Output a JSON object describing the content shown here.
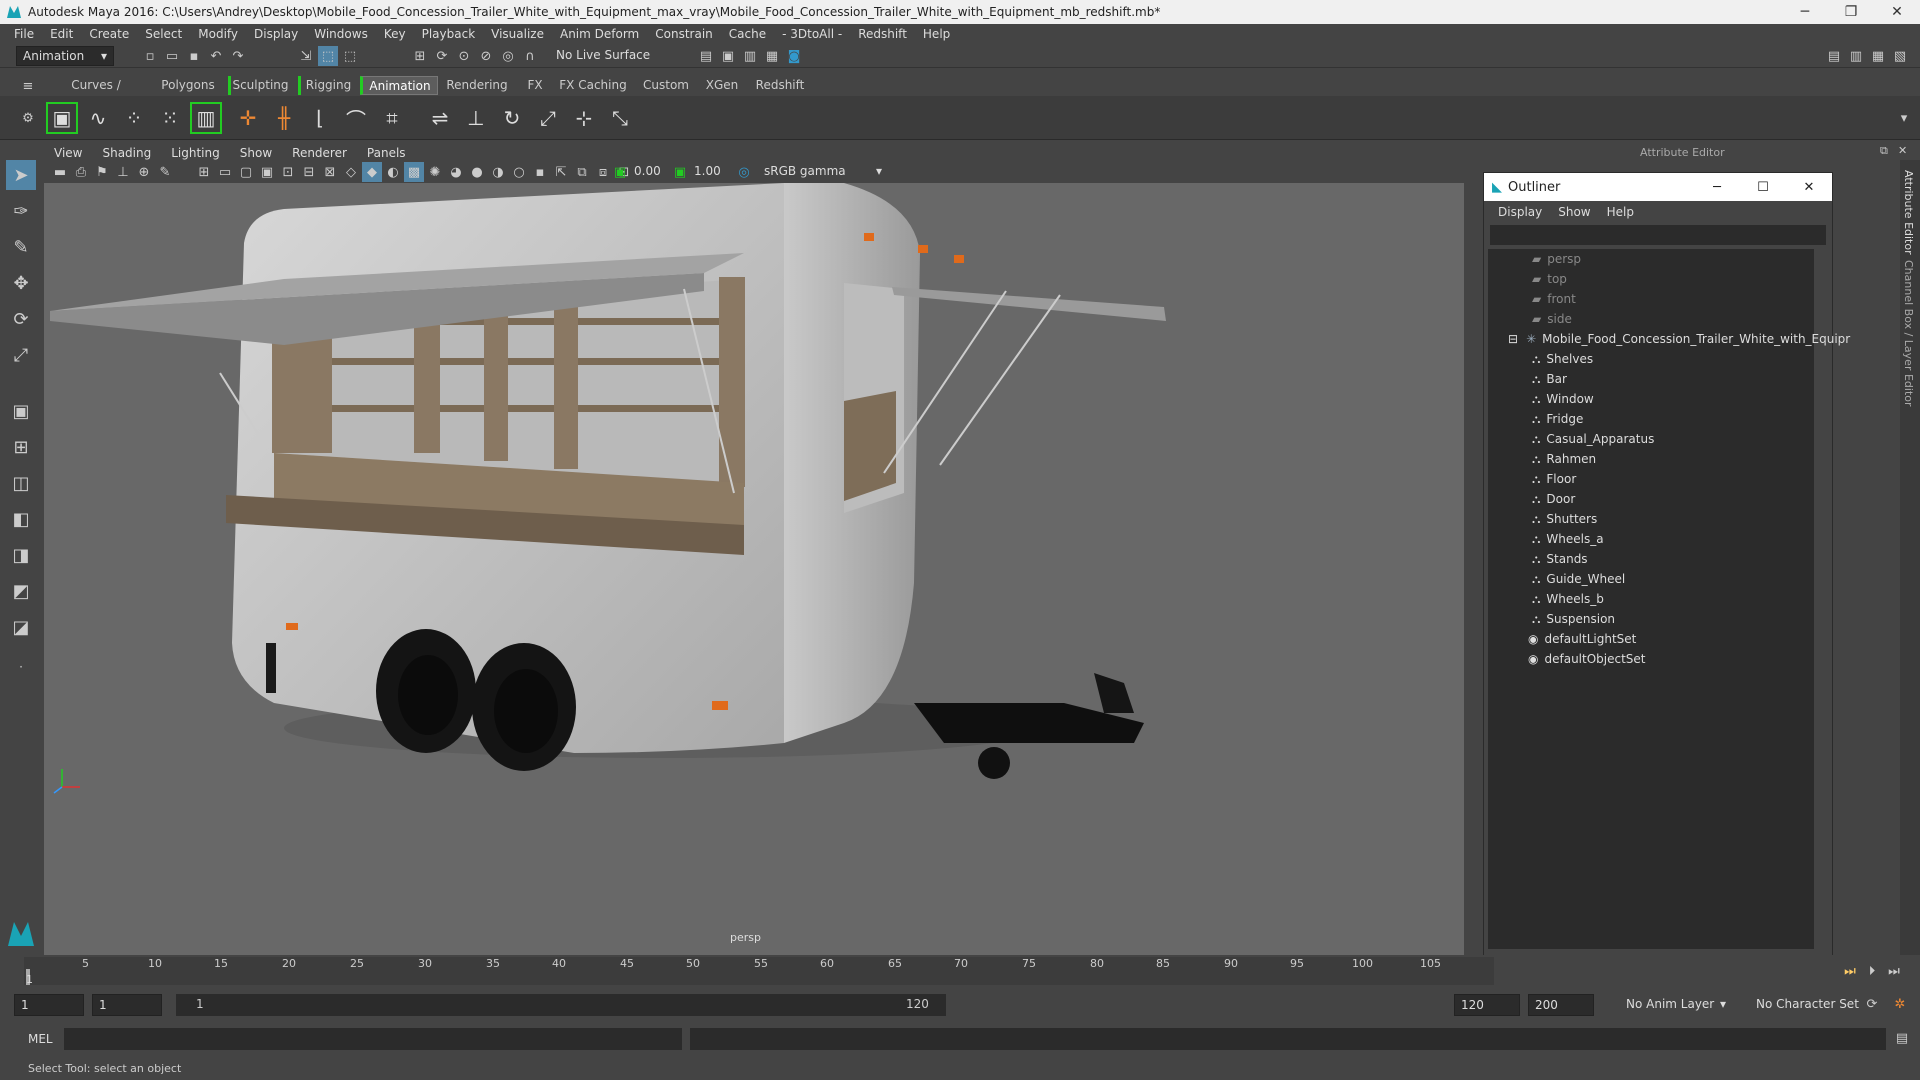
{
  "window": {
    "title": "Autodesk Maya 2016: C:\\Users\\Andrey\\Desktop\\Mobile_Food_Concession_Trailer_White_with_Equipment_max_vray\\Mobile_Food_Concession_Trailer_White_with_Equipment_mb_redshift.mb*",
    "minimize": "─",
    "restore": "❐",
    "close": "✕"
  },
  "menu": [
    "File",
    "Edit",
    "Create",
    "Select",
    "Modify",
    "Display",
    "Windows",
    "Key",
    "Playback",
    "Visualize",
    "Anim Deform",
    "Constrain",
    "Cache",
    "- 3DtoAll -",
    "Redshift",
    "Help"
  ],
  "status_line": {
    "mode": "Animation",
    "live_surface": "No Live Surface"
  },
  "shelf_tabs": [
    "Curves / Surfaces",
    "Polygons",
    "Sculpting",
    "Rigging",
    "Animation",
    "Rendering",
    "FX",
    "FX Caching",
    "Custom",
    "XGen",
    "Redshift"
  ],
  "active_shelf_tab": "Animation",
  "panel_menu": [
    "View",
    "Shading",
    "Lighting",
    "Show",
    "Renderer",
    "Panels"
  ],
  "panel_toolbar": {
    "exposure": "0.00",
    "gamma": "1.00",
    "color_space": "sRGB gamma"
  },
  "viewport": {
    "camera_label": "persp"
  },
  "attribute_editor": {
    "title": "Attribute Editor",
    "side_tab_1": "Attribute Editor",
    "side_tab_2": "Channel Box / Layer Editor"
  },
  "outliner": {
    "title": "Outliner",
    "menu": [
      "Display",
      "Show",
      "Help"
    ],
    "cameras": [
      "persp",
      "top",
      "front",
      "side"
    ],
    "root": "Mobile_Food_Concession_Trailer_White_with_Equipr",
    "children": [
      "Shelves",
      "Bar",
      "Window",
      "Fridge",
      "Casual_Apparatus",
      "Rahmen",
      "Floor",
      "Door",
      "Shutters",
      "Wheels_a",
      "Stands",
      "Guide_Wheel",
      "Wheels_b",
      "Suspension"
    ],
    "sets": [
      "defaultLightSet",
      "defaultObjectSet"
    ]
  },
  "timeline": {
    "ticks": [
      "5",
      "10",
      "15",
      "20",
      "25",
      "30",
      "35",
      "40",
      "45",
      "50",
      "55",
      "60",
      "65",
      "70",
      "75",
      "80",
      "85",
      "90",
      "95",
      "100",
      "105"
    ],
    "current_frame": "1"
  },
  "range": {
    "start": "1",
    "current": "1",
    "slider_start": "1",
    "slider_end": "120",
    "end": "120",
    "max": "200",
    "anim_layer": "No Anim Layer",
    "char_set": "No Character Set"
  },
  "command_line": {
    "lang": "MEL"
  },
  "help_line": "Select Tool: select an object"
}
